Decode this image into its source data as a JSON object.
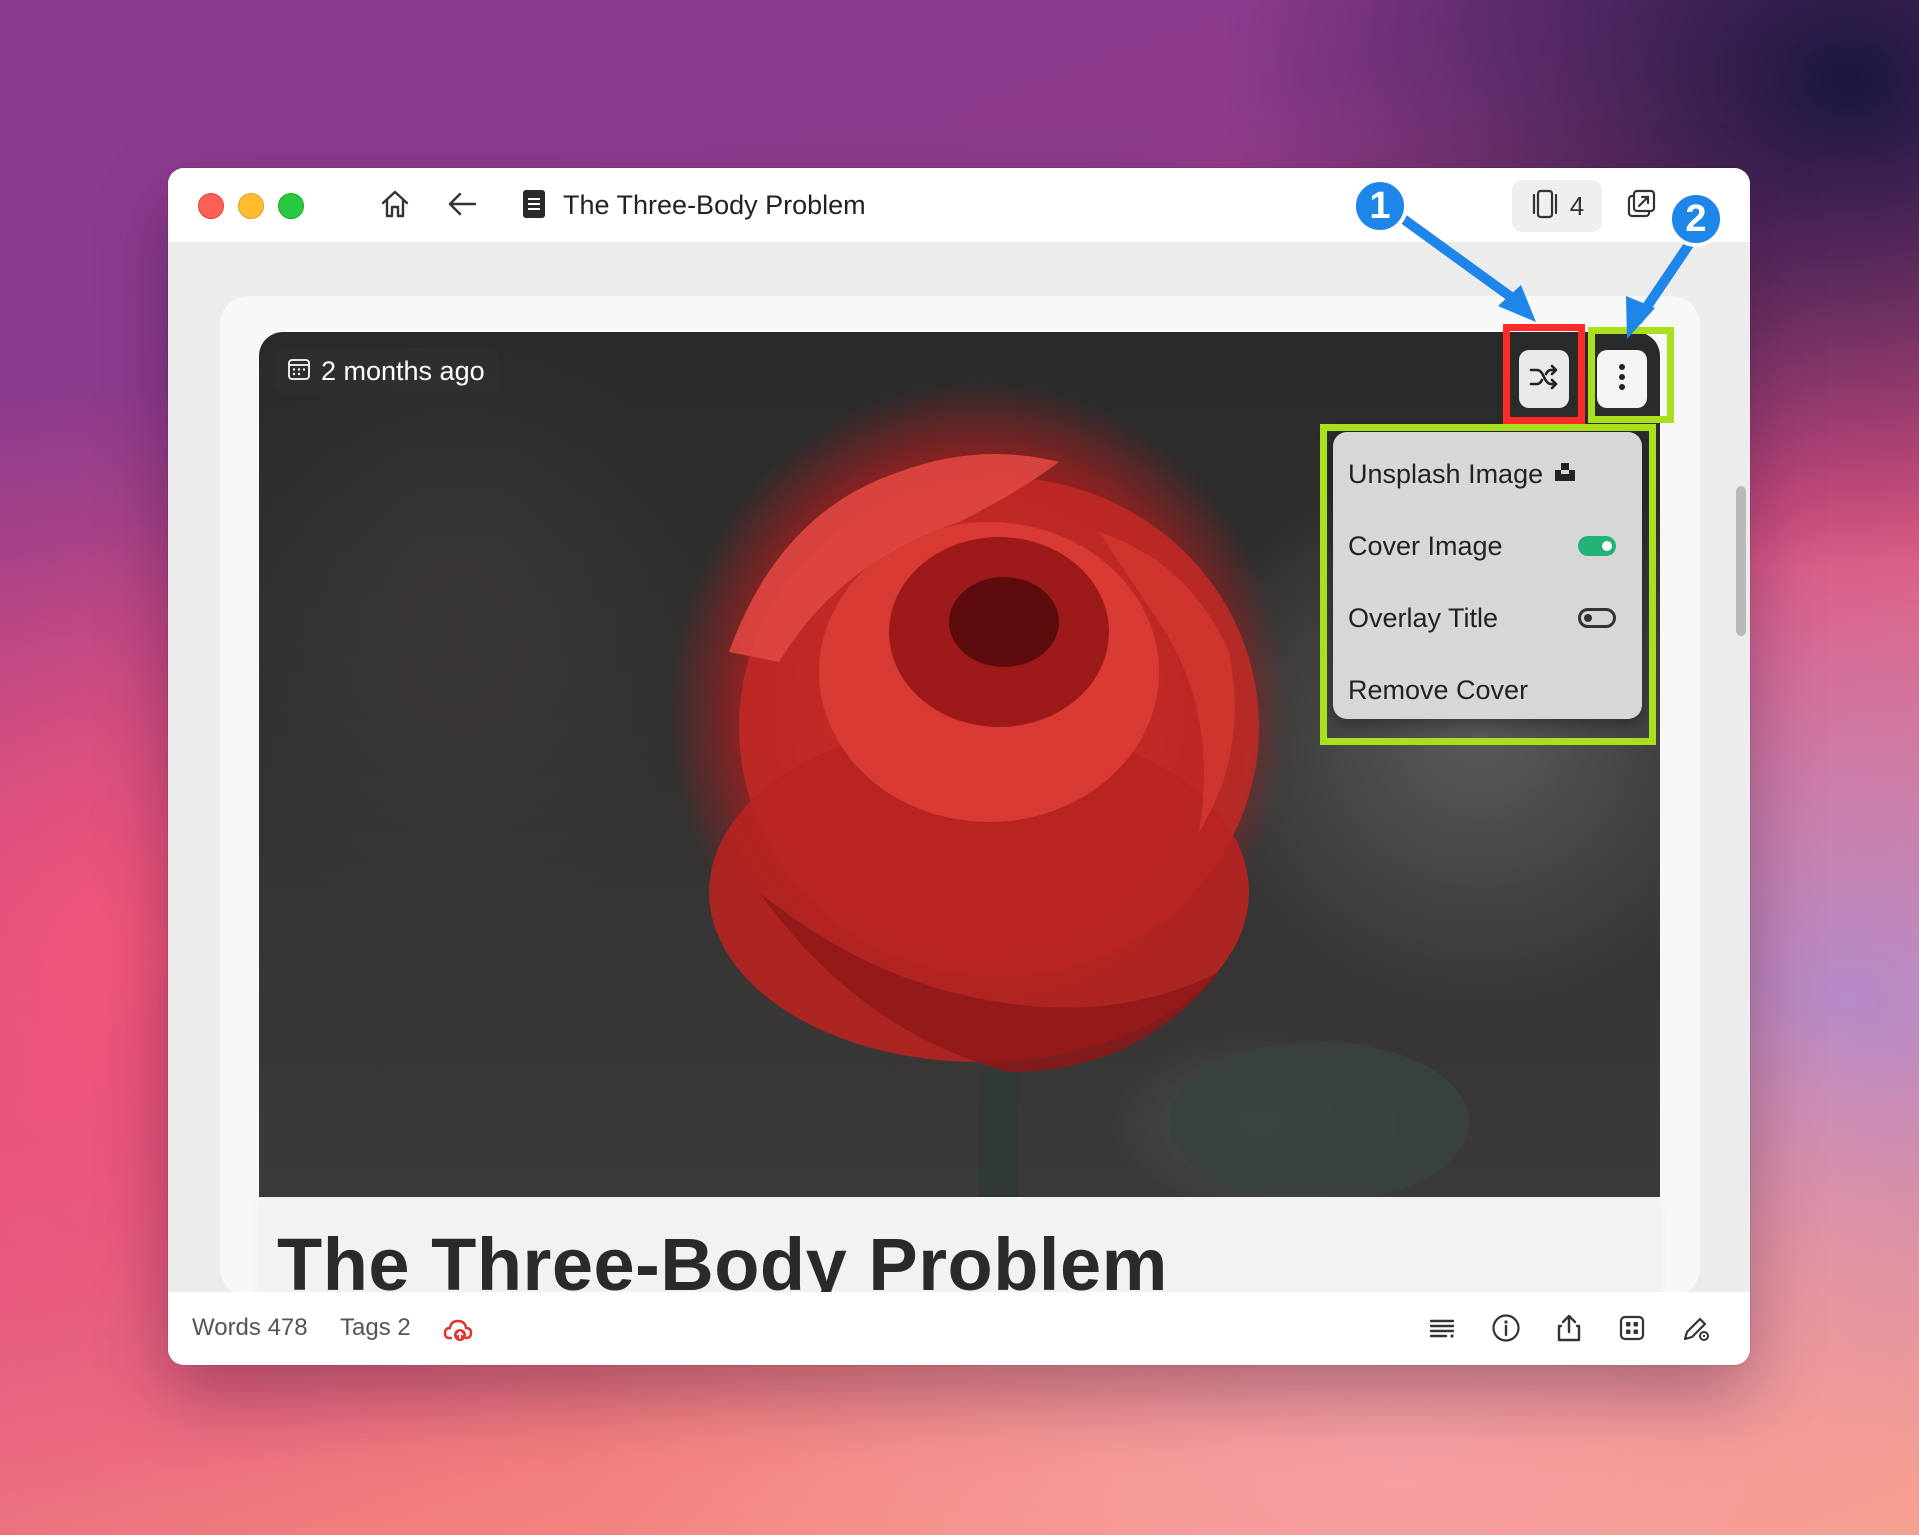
{
  "window": {
    "title": "The Three-Body Problem",
    "pages_count": "4"
  },
  "cover": {
    "date": "2 months ago",
    "menu": [
      {
        "label": "Unsplash Image",
        "icon": "unsplash-icon"
      },
      {
        "label": "Cover Image",
        "toggle": true
      },
      {
        "label": "Overlay Title",
        "toggle": false
      },
      {
        "label": "Remove Cover"
      }
    ]
  },
  "document": {
    "heading": "The Three-Body Problem"
  },
  "statusbar": {
    "words": "Words 478",
    "tags": "Tags 2"
  },
  "annotations": {
    "badge1": "1",
    "badge2": "2"
  },
  "colors": {
    "highlight_red": "#ff2a2a",
    "highlight_green": "#a8e01c",
    "badge_blue": "#1e86e8",
    "toggle_on": "#23b277"
  }
}
